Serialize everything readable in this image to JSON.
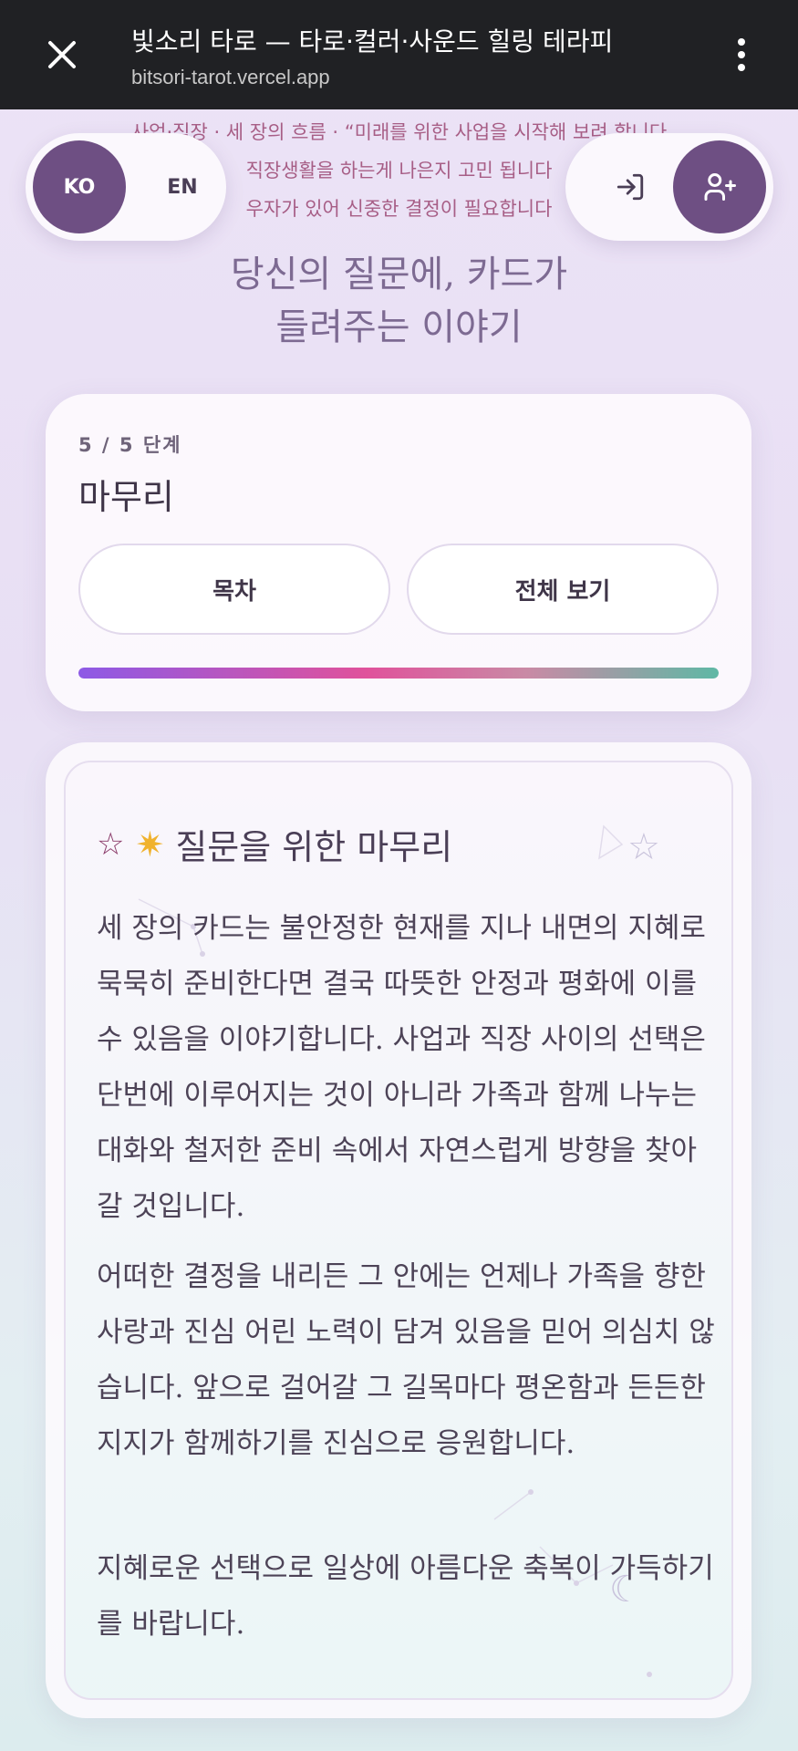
{
  "browser": {
    "title": "빛소리 타로 — 타로·컬러·사운드 힐링 테라피",
    "url": "bitsori-tarot.vercel.app"
  },
  "context": {
    "line1": "사업·직장 · 세 장의 흐름 · “미래를 위한 사업을 시작해 보려 합니다",
    "line2": "직장생활을 하는게 나은지 고민 됩니다",
    "line3": "우자가 있어 신중한 결정이 필요합니다"
  },
  "lang": {
    "ko": "KO",
    "en": "EN"
  },
  "headline": {
    "line1": "당신의 질문에, 카드가",
    "line2": "들려주는 이야기"
  },
  "step": {
    "label": "5 / 5 단계",
    "title": "마무리",
    "toc_label": "목차",
    "view_all_label": "전체 보기",
    "progress": 1.0
  },
  "closing": {
    "title": "질문을 위한 마무리",
    "paragraphs": [
      "세 장의 카드는 불안정한 현재를 지나 내면의 지혜로 묵묵히 준비한다면 결국 따뜻한 안정과 평화에 이를 수 있음을 이야기합니다. 사업과 직장 사이의 선택은 단번에 이루어지는 것이 아니라 가족과 함께 나누는 대화와 철저한 준비 속에서 자연스럽게 방향을 찾아갈 것입니다.",
      "어떠한 결정을 내리든 그 안에는 언제나 가족을 향한 사랑과 진심 어린 노력이 담겨 있음을 믿어 의심치 않습니다. 앞으로 걸어갈 그 길목마다 평온함과 든든한 지지가 함께하기를 진심으로 응원합니다.",
      "지혜로운 선택으로 일상에 아름다운 축복이 가득하기를 바랍니다."
    ]
  },
  "colors": {
    "accent": "#6e4f83",
    "browser_bar": "#202124"
  }
}
